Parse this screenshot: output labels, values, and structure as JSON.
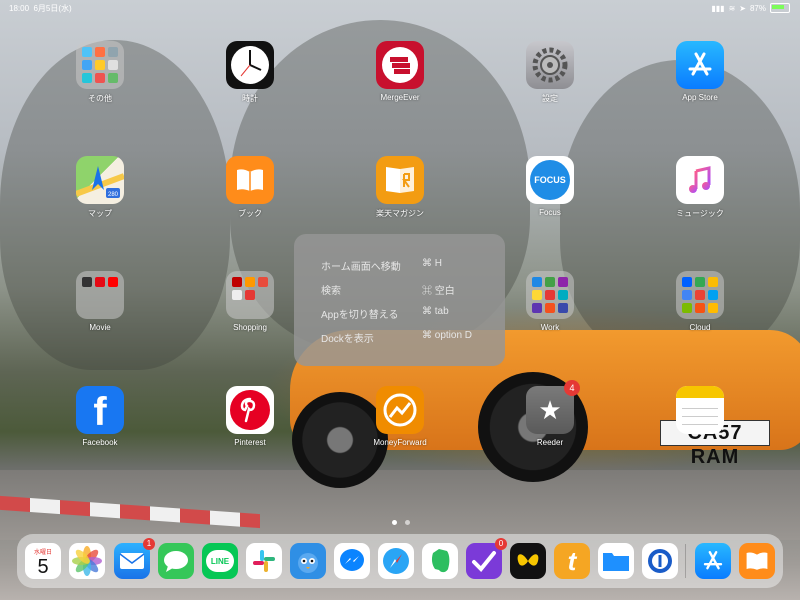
{
  "status_bar": {
    "time": "18:00",
    "date": "6月5日(水)",
    "battery": "87%"
  },
  "home": {
    "apps": [
      {
        "label": "その他"
      },
      {
        "label": "時計"
      },
      {
        "label": "MergeEver"
      },
      {
        "label": "設定"
      },
      {
        "label": "App Store"
      },
      {
        "label": "マップ"
      },
      {
        "label": "ブック"
      },
      {
        "label": "楽天マガジン"
      },
      {
        "label": "Focus",
        "icon_text": "FOCUS"
      },
      {
        "label": "ミュージック"
      },
      {
        "label": "Movie"
      },
      {
        "label": "Shopping"
      },
      {
        "label": "Work"
      },
      {
        "label": "Cloud"
      },
      {
        "label": "Facebook",
        "icon_text": "f"
      },
      {
        "label": "Pinterest"
      },
      {
        "label": "MoneyForward"
      },
      {
        "label": "Reeder",
        "badge": "4"
      }
    ]
  },
  "map_icon": {
    "route_number": "280"
  },
  "plate": "CA57 RAM",
  "keyboard_shortcuts": {
    "items": [
      {
        "action": "ホーム画面へ移動",
        "key": "⌘ H"
      },
      {
        "action": "検索",
        "key": "⌘ 空白"
      },
      {
        "action": "Appを切り替える",
        "key": "⌘ tab"
      },
      {
        "action": "Dockを表示",
        "key": "⌘ option D"
      }
    ]
  },
  "dock": {
    "calendar": {
      "weekday": "水曜日",
      "day": "5"
    },
    "mail_badge": "1",
    "omnifocus_badge": "0",
    "line_label": "LINE"
  },
  "colors": {
    "accent": "#1a8cff",
    "badge": "#e53935",
    "line_green": "#06c755"
  }
}
